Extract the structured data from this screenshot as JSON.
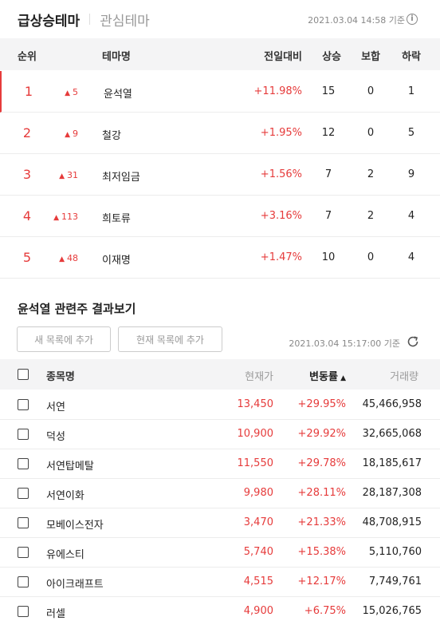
{
  "tabs": {
    "active": "급상승테마",
    "inactive": "관심테마"
  },
  "top_timestamp": "2021.03.04 14:58 기준",
  "info_icon_glyph": "i",
  "theme_table": {
    "headers": {
      "rank": "순위",
      "name": "테마명",
      "change_pct": "전일대비",
      "up": "상승",
      "flat": "보합",
      "down": "하락"
    },
    "rows": [
      {
        "rank": "1",
        "rank_change": "5",
        "name": "윤석열",
        "pct": "+11.98%",
        "up": "15",
        "flat": "0",
        "down": "1"
      },
      {
        "rank": "2",
        "rank_change": "9",
        "name": "철강",
        "pct": "+1.95%",
        "up": "12",
        "flat": "0",
        "down": "5"
      },
      {
        "rank": "3",
        "rank_change": "31",
        "name": "최저임금",
        "pct": "+1.56%",
        "up": "7",
        "flat": "2",
        "down": "9"
      },
      {
        "rank": "4",
        "rank_change": "113",
        "name": "희토류",
        "pct": "+3.16%",
        "up": "7",
        "flat": "2",
        "down": "4"
      },
      {
        "rank": "5",
        "rank_change": "48",
        "name": "이재명",
        "pct": "+1.47%",
        "up": "10",
        "flat": "0",
        "down": "4"
      }
    ]
  },
  "related": {
    "title": "윤석열 관련주 결과보기",
    "btn_new": "새 목록에 추가",
    "btn_current": "현재 목록에 추가",
    "timestamp": "2021.03.04 15:17:00 기준",
    "headers": {
      "name": "종목명",
      "price": "현재가",
      "rate": "변동률",
      "volume": "거래량"
    },
    "rows": [
      {
        "name": "서연",
        "price": "13,450",
        "rate": "+29.95%",
        "volume": "45,466,958"
      },
      {
        "name": "덕성",
        "price": "10,900",
        "rate": "+29.92%",
        "volume": "32,665,068"
      },
      {
        "name": "서연탑메탈",
        "price": "11,550",
        "rate": "+29.78%",
        "volume": "18,185,617"
      },
      {
        "name": "서연이화",
        "price": "9,980",
        "rate": "+28.11%",
        "volume": "28,187,308"
      },
      {
        "name": "모베이스전자",
        "price": "3,470",
        "rate": "+21.33%",
        "volume": "48,708,915"
      },
      {
        "name": "유에스티",
        "price": "5,740",
        "rate": "+15.38%",
        "volume": "5,110,760"
      },
      {
        "name": "아이크래프트",
        "price": "4,515",
        "rate": "+12.17%",
        "volume": "7,749,761"
      },
      {
        "name": "러셀",
        "price": "4,900",
        "rate": "+6.75%",
        "volume": "15,026,765"
      }
    ]
  },
  "colors": {
    "up_red": "#e63b3b",
    "header_bg": "#f4f4f5"
  },
  "icons": {
    "info": "info-circle-icon",
    "refresh": "refresh-icon",
    "rank_up": "triangle-up-icon",
    "sort": "sort-desc-icon"
  }
}
